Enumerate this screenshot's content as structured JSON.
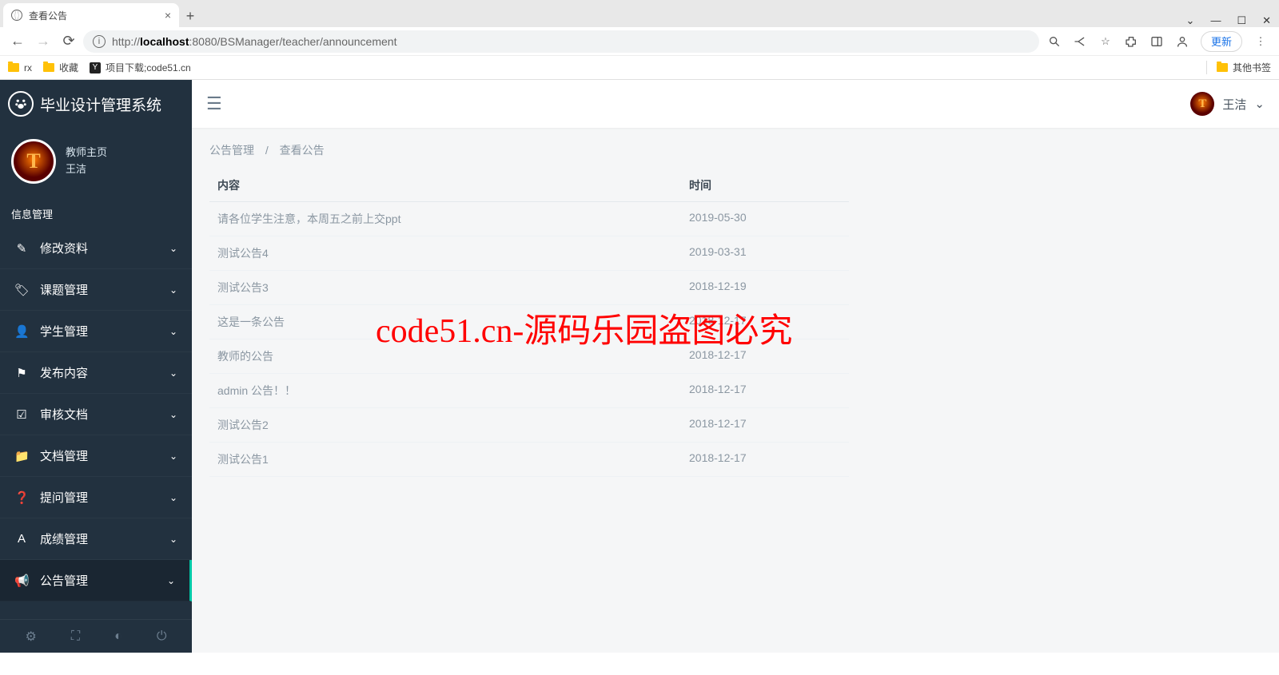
{
  "browser": {
    "tab_title": "查看公告",
    "url_prefix": "http://",
    "url_host": "localhost",
    "url_rest": ":8080/BSManager/teacher/announcement",
    "update_label": "更新",
    "bookmarks": [
      "rx",
      "收藏",
      "项目下载;code51.cn"
    ],
    "other_bookmarks": "其他书签"
  },
  "brand": "毕业设计管理系统",
  "user": {
    "role": "教师主页",
    "name": "王洁"
  },
  "section_label": "信息管理",
  "nav": [
    {
      "label": "修改资料",
      "icon": "✎",
      "data_name": "sidebar-item-profile"
    },
    {
      "label": "课题管理",
      "icon": "🏷",
      "data_name": "sidebar-item-topic"
    },
    {
      "label": "学生管理",
      "icon": "👤",
      "data_name": "sidebar-item-student"
    },
    {
      "label": "发布内容",
      "icon": "⚑",
      "data_name": "sidebar-item-publish"
    },
    {
      "label": "审核文档",
      "icon": "☑",
      "data_name": "sidebar-item-review"
    },
    {
      "label": "文档管理",
      "icon": "📁",
      "data_name": "sidebar-item-docs"
    },
    {
      "label": "提问管理",
      "icon": "❓",
      "data_name": "sidebar-item-question"
    },
    {
      "label": "成绩管理",
      "icon": "A",
      "data_name": "sidebar-item-grade"
    },
    {
      "label": "公告管理",
      "icon": "📢",
      "data_name": "sidebar-item-announce",
      "active": true
    }
  ],
  "breadcrumb": {
    "a": "公告管理",
    "b": "查看公告"
  },
  "table": {
    "head_content": "内容",
    "head_time": "时间",
    "rows": [
      {
        "content": "请各位学生注意，本周五之前上交ppt",
        "time": "2019-05-30"
      },
      {
        "content": "测试公告4",
        "time": "2019-03-31"
      },
      {
        "content": "测试公告3",
        "time": "2018-12-19"
      },
      {
        "content": "这是一条公告",
        "time": "2018-12-17"
      },
      {
        "content": "教师的公告",
        "time": "2018-12-17"
      },
      {
        "content": "admin 公告！！",
        "time": "2018-12-17"
      },
      {
        "content": "测试公告2",
        "time": "2018-12-17"
      },
      {
        "content": "测试公告1",
        "time": "2018-12-17"
      }
    ]
  },
  "watermark": "code51.cn-源码乐园盗图必究"
}
